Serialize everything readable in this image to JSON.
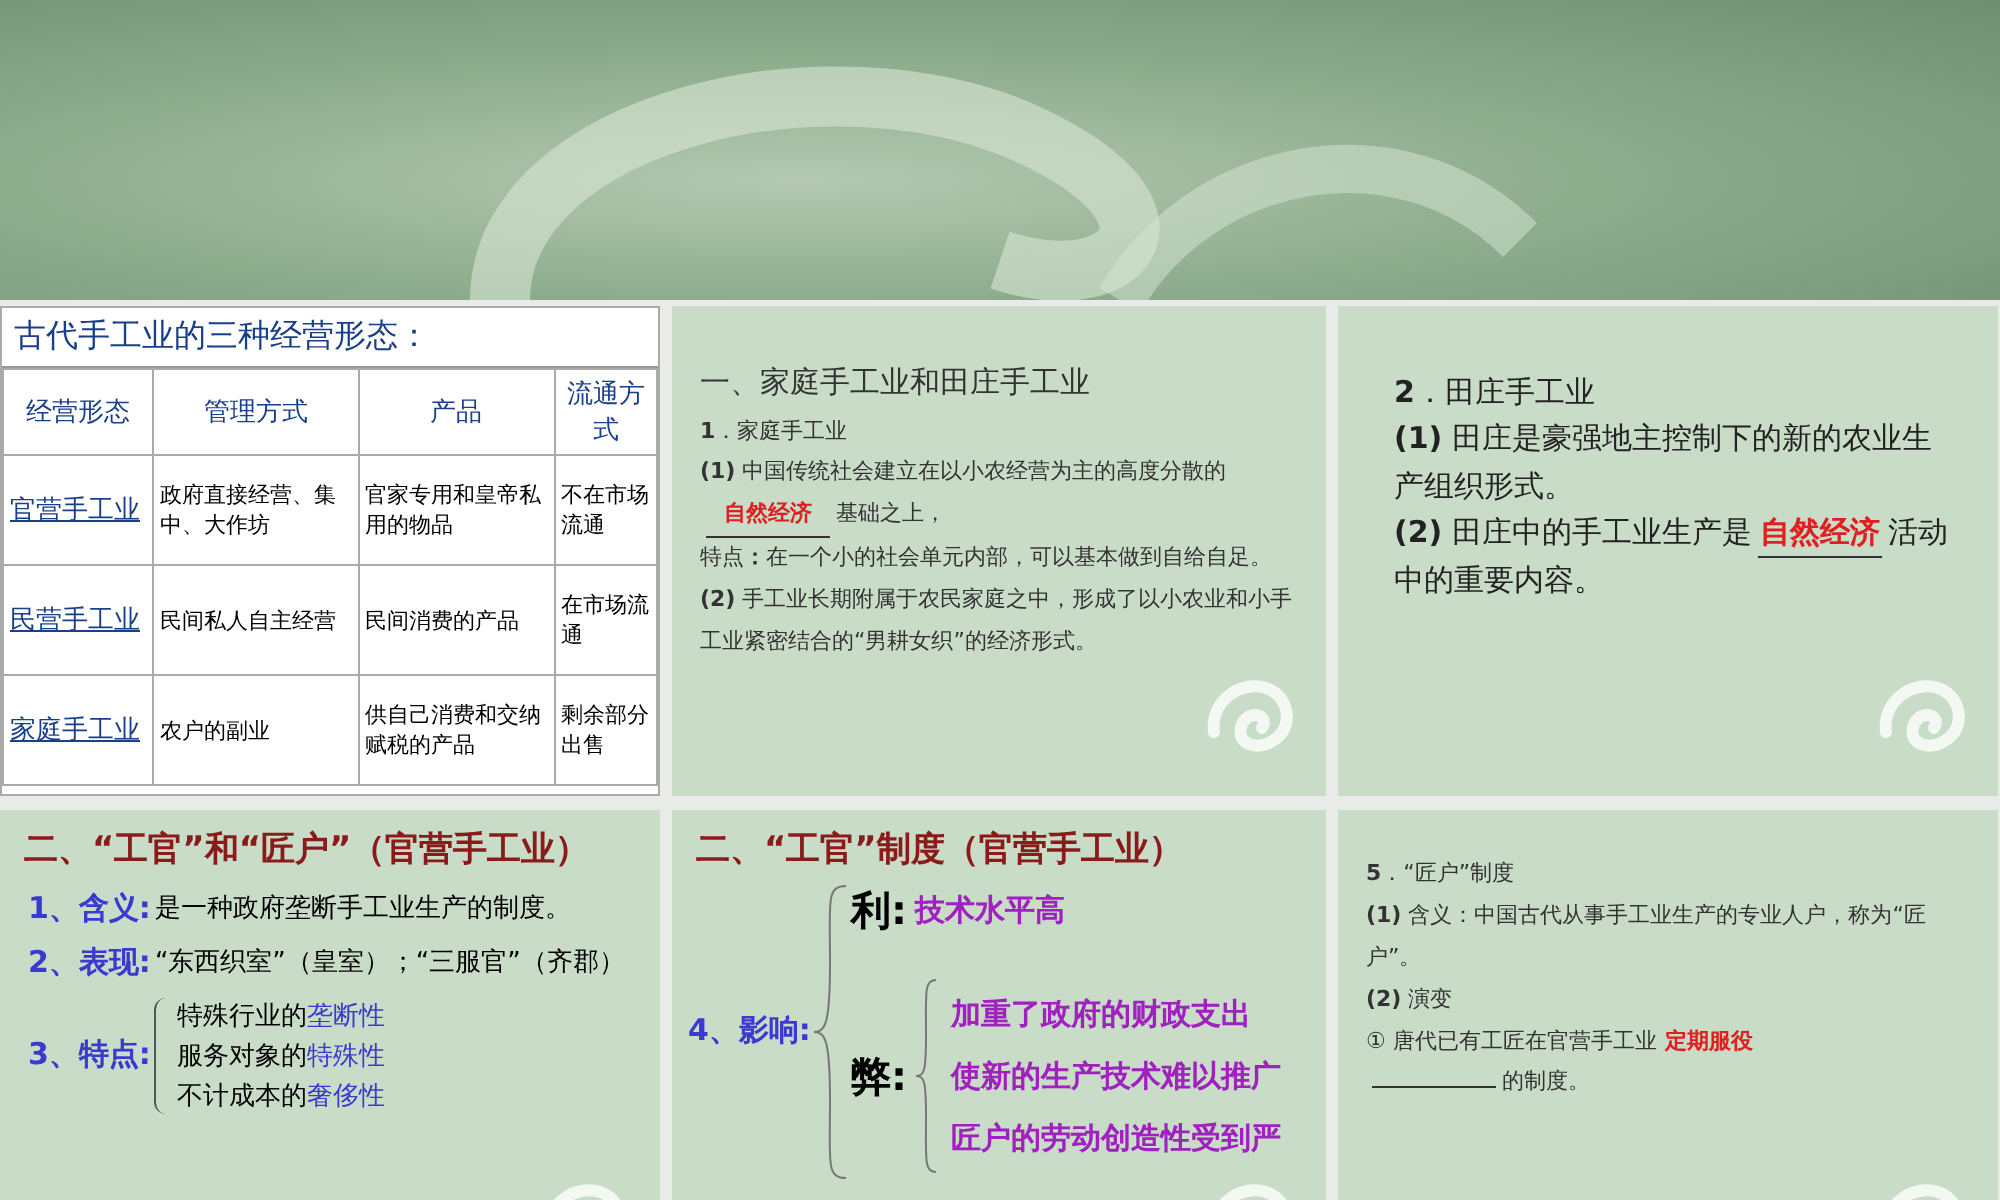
{
  "slides": [
    {
      "kind": "table",
      "title": "古代手工业的三种经营形态：",
      "columns": [
        "经营形态",
        "管理方式",
        "产品",
        "流通方式"
      ],
      "rows": [
        [
          "官营手工业",
          "政府直接经营、集中、大作坊",
          "官家专用和皇帝私用的物品",
          "不在市场流通"
        ],
        [
          "民营手工业",
          "民间私人自主经营",
          "民间消费的产品",
          "在市场流通"
        ],
        [
          "家庭手工业",
          "农户的副业",
          "供自己消费和交纳赋税的产品",
          "剩余部分出售"
        ]
      ]
    },
    {
      "kind": "notes",
      "heading": "一、家庭手工业和田庄手工业",
      "paragraphs": [
        {
          "parts": [
            {
              "kind": "text",
              "text": "**1**．家庭手工业"
            }
          ]
        },
        {
          "parts": [
            {
              "kind": "text",
              "text": "**(1)** 中国传统社会建立在以小农经营为主的高度分散的"
            },
            {
              "kind": "blank",
              "text": "自然经济"
            },
            {
              "kind": "text",
              "text": "基础之上，"
            }
          ]
        },
        {
          "parts": [
            {
              "kind": "text",
              "text": "特点**：**在一个小的社会单元内部，可以基本做到自给自足。"
            }
          ]
        },
        {
          "parts": [
            {
              "kind": "text",
              "text": "**(2)** 手工业长期附属于农民家庭之中，形成了以小农业和小手工业紧密结合的“男耕女织”的经济形式。"
            }
          ]
        }
      ]
    },
    {
      "kind": "notes_large",
      "paragraphs": [
        {
          "parts": [
            {
              "kind": "text",
              "text": "**2**．田庄手工业"
            }
          ]
        },
        {
          "parts": [
            {
              "kind": "text",
              "text": "**(1)** 田庄是豪强地主控制下的新的农业生产组织形式。"
            }
          ]
        },
        {
          "parts": [
            {
              "kind": "text",
              "text": "**(2)** 田庄中的手工业生产是"
            },
            {
              "kind": "blank",
              "text": "自然经济"
            },
            {
              "kind": "text",
              "text": "活动中的重要内容。"
            }
          ]
        }
      ]
    },
    {
      "kind": "outline",
      "heading": "二、“工官”和“匠户”（官营手工业）",
      "items": [
        {
          "label": "1、含义:",
          "text": "是一种政府垄断手工业生产的制度。"
        },
        {
          "label": "2、表现:",
          "text": "“东西织室”（皇室）；“三服官”（齐郡）"
        },
        {
          "label": "3、特点:",
          "features": [
            {
              "text": "特殊行业的",
              "highlight": "垄断性"
            },
            {
              "text": "服务对象的",
              "highlight": "特殊性"
            },
            {
              "text": "不计成本的",
              "highlight": "奢侈性"
            }
          ]
        }
      ]
    },
    {
      "kind": "impact",
      "heading": "二、“工官”制度（官营手工业）",
      "label": "4、影响:",
      "pros_label": "利:",
      "pros": [
        "技术水平高"
      ],
      "cons_label": "弊:",
      "cons": [
        "加重了政府的财政支出",
        "使新的生产技术难以推广",
        "匠户的劳动创造性受到严"
      ]
    },
    {
      "kind": "notes",
      "paragraphs": [
        {
          "parts": [
            {
              "kind": "text",
              "text": "**5**．“匠户”制度"
            }
          ]
        },
        {
          "parts": [
            {
              "kind": "text",
              "text": "**(1)** 含义：中国古代从事手工业生产的专业人户，称为“匠户”。"
            }
          ]
        },
        {
          "parts": [
            {
              "kind": "text",
              "text": "**(2)** 演变"
            }
          ]
        },
        {
          "parts": [
            {
              "kind": "text",
              "text": "① 唐代已有工匠在官营手工业"
            },
            {
              "kind": "overlay",
              "text": "定期服役"
            }
          ]
        },
        {
          "parts": [
            {
              "kind": "empty_blank"
            },
            {
              "kind": "text",
              "text": "的制度。"
            }
          ]
        }
      ]
    }
  ]
}
